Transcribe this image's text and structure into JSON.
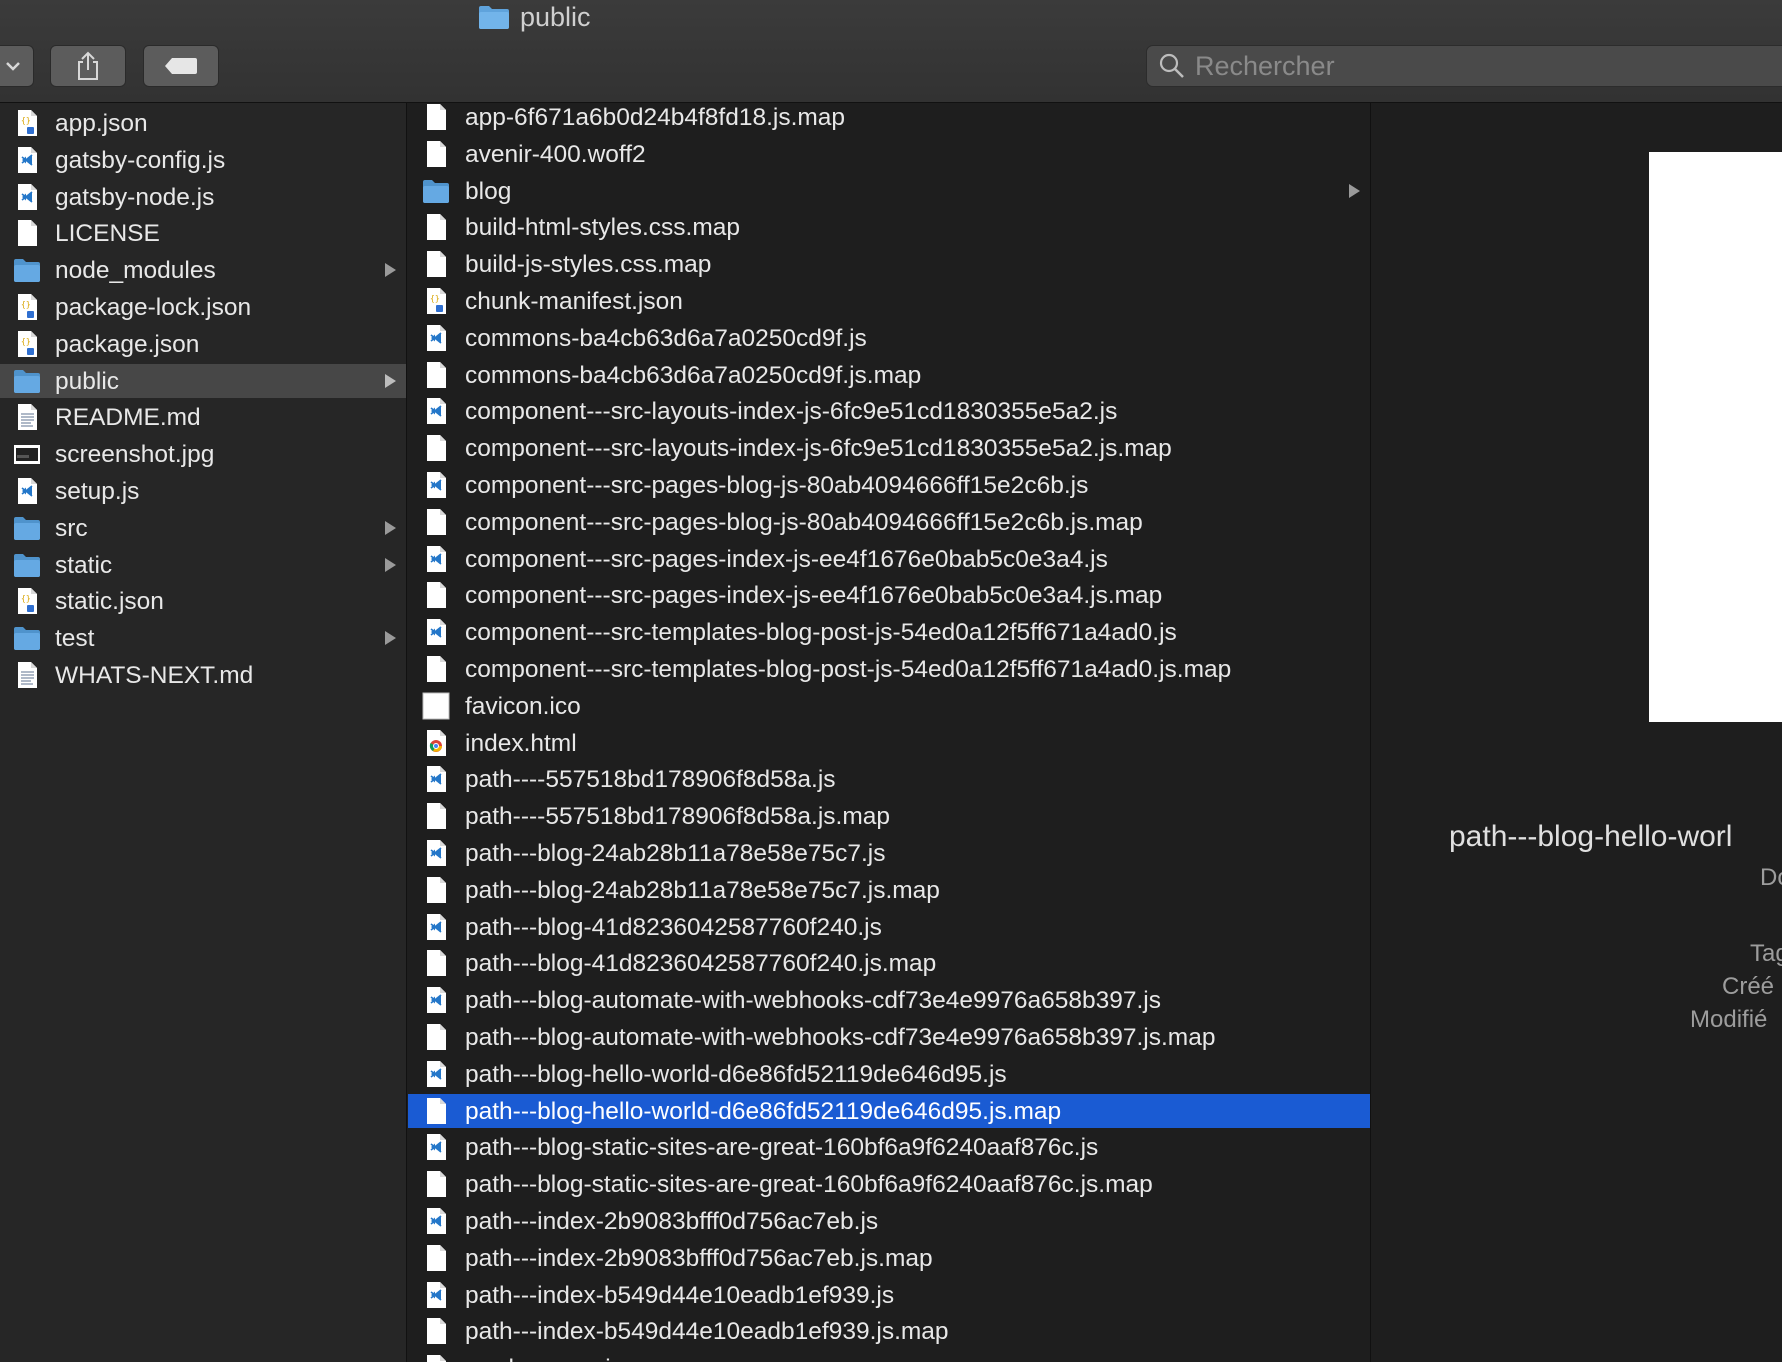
{
  "window": {
    "title": "public",
    "title_icon": "folder-icon"
  },
  "toolbar": {
    "view_menu_icon": "chevron-down-icon",
    "share_icon": "share-icon",
    "tag_icon": "tag-icon",
    "search_placeholder": "Rechercher"
  },
  "colors": {
    "selection_blue": "#1a5bd3",
    "selection_grey": "#474747",
    "folder": "#5fa3dc",
    "vscode_blue": "#2477c9"
  },
  "column1": {
    "items": [
      {
        "label": "app.json",
        "icon": "json-file-icon",
        "folder": false
      },
      {
        "label": "gatsby-config.js",
        "icon": "vscode-file-icon",
        "folder": false
      },
      {
        "label": "gatsby-node.js",
        "icon": "vscode-file-icon",
        "folder": false
      },
      {
        "label": "LICENSE",
        "icon": "document-icon",
        "folder": false
      },
      {
        "label": "node_modules",
        "icon": "folder-icon",
        "folder": true
      },
      {
        "label": "package-lock.json",
        "icon": "json-file-icon",
        "folder": false
      },
      {
        "label": "package.json",
        "icon": "json-file-icon",
        "folder": false
      },
      {
        "label": "public",
        "icon": "folder-icon",
        "folder": true,
        "selected": true
      },
      {
        "label": "README.md",
        "icon": "text-file-icon",
        "folder": false
      },
      {
        "label": "screenshot.jpg",
        "icon": "image-file-icon",
        "folder": false
      },
      {
        "label": "setup.js",
        "icon": "vscode-file-icon",
        "folder": false
      },
      {
        "label": "src",
        "icon": "folder-icon",
        "folder": true
      },
      {
        "label": "static",
        "icon": "folder-icon",
        "folder": true
      },
      {
        "label": "static.json",
        "icon": "json-file-icon",
        "folder": false
      },
      {
        "label": "test",
        "icon": "folder-icon",
        "folder": true
      },
      {
        "label": "WHATS-NEXT.md",
        "icon": "text-file-icon",
        "folder": false
      }
    ]
  },
  "column2": {
    "items": [
      {
        "label": "app-6f671a6b0d24b4f8fd18.js.map",
        "icon": "document-icon"
      },
      {
        "label": "avenir-400.woff2",
        "icon": "document-icon"
      },
      {
        "label": "blog",
        "icon": "folder-icon",
        "folder": true
      },
      {
        "label": "build-html-styles.css.map",
        "icon": "document-icon"
      },
      {
        "label": "build-js-styles.css.map",
        "icon": "document-icon"
      },
      {
        "label": "chunk-manifest.json",
        "icon": "json-file-icon"
      },
      {
        "label": "commons-ba4cb63d6a7a0250cd9f.js",
        "icon": "vscode-file-icon"
      },
      {
        "label": "commons-ba4cb63d6a7a0250cd9f.js.map",
        "icon": "document-icon"
      },
      {
        "label": "component---src-layouts-index-js-6fc9e51cd1830355e5a2.js",
        "icon": "vscode-file-icon"
      },
      {
        "label": "component---src-layouts-index-js-6fc9e51cd1830355e5a2.js.map",
        "icon": "document-icon"
      },
      {
        "label": "component---src-pages-blog-js-80ab4094666ff15e2c6b.js",
        "icon": "vscode-file-icon"
      },
      {
        "label": "component---src-pages-blog-js-80ab4094666ff15e2c6b.js.map",
        "icon": "document-icon"
      },
      {
        "label": "component---src-pages-index-js-ee4f1676e0bab5c0e3a4.js",
        "icon": "vscode-file-icon"
      },
      {
        "label": "component---src-pages-index-js-ee4f1676e0bab5c0e3a4.js.map",
        "icon": "document-icon"
      },
      {
        "label": "component---src-templates-blog-post-js-54ed0a12f5ff671a4ad0.js",
        "icon": "vscode-file-icon"
      },
      {
        "label": "component---src-templates-blog-post-js-54ed0a12f5ff671a4ad0.js.map",
        "icon": "document-icon"
      },
      {
        "label": "favicon.ico",
        "icon": "blank-image-icon"
      },
      {
        "label": "index.html",
        "icon": "chrome-file-icon"
      },
      {
        "label": "path----557518bd178906f8d58a.js",
        "icon": "vscode-file-icon"
      },
      {
        "label": "path----557518bd178906f8d58a.js.map",
        "icon": "document-icon"
      },
      {
        "label": "path---blog-24ab28b11a78e58e75c7.js",
        "icon": "vscode-file-icon"
      },
      {
        "label": "path---blog-24ab28b11a78e58e75c7.js.map",
        "icon": "document-icon"
      },
      {
        "label": "path---blog-41d8236042587760f240.js",
        "icon": "vscode-file-icon"
      },
      {
        "label": "path---blog-41d8236042587760f240.js.map",
        "icon": "document-icon"
      },
      {
        "label": "path---blog-automate-with-webhooks-cdf73e4e9976a658b397.js",
        "icon": "vscode-file-icon"
      },
      {
        "label": "path---blog-automate-with-webhooks-cdf73e4e9976a658b397.js.map",
        "icon": "document-icon"
      },
      {
        "label": "path---blog-hello-world-d6e86fd52119de646d95.js",
        "icon": "vscode-file-icon"
      },
      {
        "label": "path---blog-hello-world-d6e86fd52119de646d95.js.map",
        "icon": "document-icon",
        "selected": true
      },
      {
        "label": "path---blog-static-sites-are-great-160bf6a9f6240aaf876c.js",
        "icon": "vscode-file-icon"
      },
      {
        "label": "path---blog-static-sites-are-great-160bf6a9f6240aaf876c.js.map",
        "icon": "document-icon"
      },
      {
        "label": "path---index-2b9083bfff0d756ac7eb.js",
        "icon": "vscode-file-icon"
      },
      {
        "label": "path---index-2b9083bfff0d756ac7eb.js.map",
        "icon": "document-icon"
      },
      {
        "label": "path---index-b549d44e10eadb1ef939.js",
        "icon": "vscode-file-icon"
      },
      {
        "label": "path---index-b549d44e10eadb1ef939.js.map",
        "icon": "document-icon"
      },
      {
        "label": "render-page.js.map",
        "icon": "document-icon"
      }
    ]
  },
  "preview": {
    "filename": "path---blog-hello-worl",
    "kind_fragment": "Do",
    "tags_label": "Tag",
    "created_label": "Créé",
    "modified_label": "Modifié"
  }
}
